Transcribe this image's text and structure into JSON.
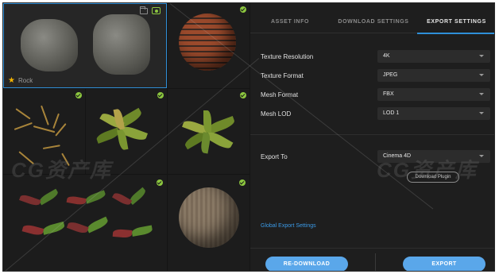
{
  "assets": {
    "selected_label": "Rock"
  },
  "tabs": [
    {
      "label": "ASSET INFO"
    },
    {
      "label": "DOWNLOAD SETTINGS"
    },
    {
      "label": "EXPORT SETTINGS"
    }
  ],
  "settings": {
    "texture_resolution": {
      "label": "Texture Resolution",
      "value": "4K"
    },
    "texture_format": {
      "label": "Texture Format",
      "value": "JPEG"
    },
    "mesh_format": {
      "label": "Mesh Format",
      "value": "FBX"
    },
    "mesh_lod": {
      "label": "Mesh LOD",
      "value": "LOD 1"
    },
    "export_to": {
      "label": "Export To",
      "value": "Cinema 4D"
    }
  },
  "download_plugin_label": "Download Plugin",
  "global_export_settings_label": "Global Export Settings",
  "buttons": {
    "redownload": "RE-DOWNLOAD",
    "export": "EXPORT"
  },
  "watermark_text": "CG资产库",
  "colors": {
    "accent": "#2f8fd8",
    "button": "#5aa7ea",
    "check": "#8cc63f",
    "star": "#f5b400"
  }
}
